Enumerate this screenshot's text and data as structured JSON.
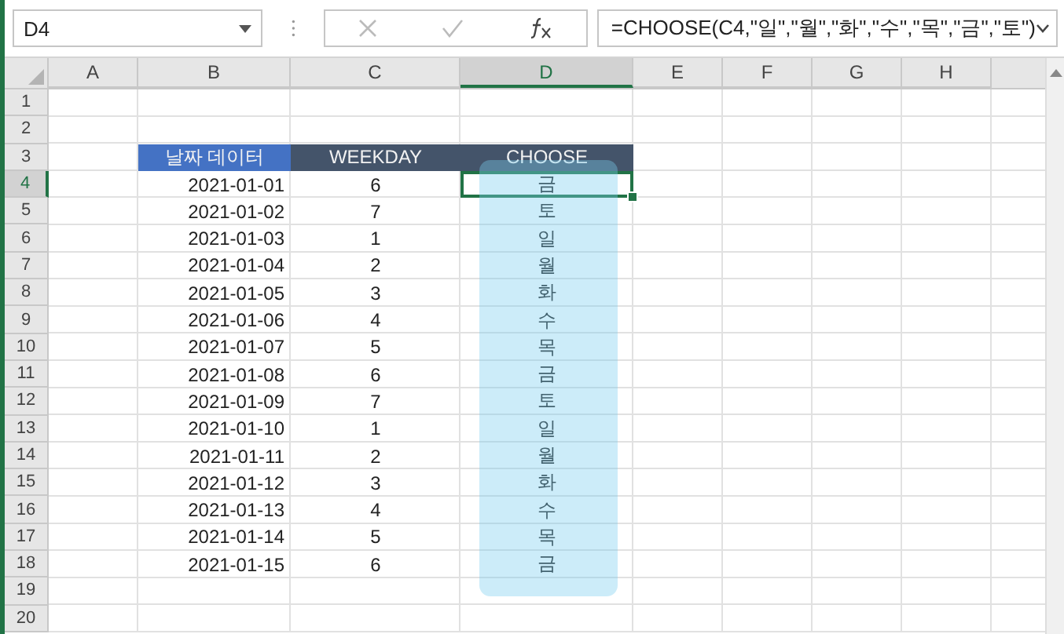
{
  "name_box": "D4",
  "formula": "=CHOOSE(C4,\"일\",\"월\",\"화\",\"수\",\"목\",\"금\",\"토\")",
  "columns": [
    {
      "label": "A",
      "selected": false
    },
    {
      "label": "B",
      "selected": false
    },
    {
      "label": "C",
      "selected": false
    },
    {
      "label": "D",
      "selected": true
    },
    {
      "label": "E",
      "selected": false
    },
    {
      "label": "F",
      "selected": false
    },
    {
      "label": "G",
      "selected": false
    },
    {
      "label": "H",
      "selected": false
    }
  ],
  "rows": [
    {
      "label": "1",
      "selected": false
    },
    {
      "label": "2",
      "selected": false
    },
    {
      "label": "3",
      "selected": false,
      "cells": [
        {
          "text": "날짜 데이터",
          "color": "#4472c4"
        },
        {
          "text": "WEEKDAY",
          "color": "#44546a"
        },
        {
          "text": "CHOOSE",
          "color": "#44546a"
        }
      ]
    },
    {
      "label": "4",
      "selected": true,
      "cells": [
        {
          "text": "2021-01-01"
        },
        {
          "text": "6"
        },
        {
          "text": "금",
          "selected": true
        }
      ]
    },
    {
      "label": "5",
      "selected": false,
      "cells": [
        {
          "text": "2021-01-02"
        },
        {
          "text": "7"
        },
        {
          "text": "토",
          "selected": false
        }
      ]
    },
    {
      "label": "6",
      "selected": false,
      "cells": [
        {
          "text": "2021-01-03"
        },
        {
          "text": "1"
        },
        {
          "text": "일",
          "selected": false
        }
      ]
    },
    {
      "label": "7",
      "selected": false,
      "cells": [
        {
          "text": "2021-01-04"
        },
        {
          "text": "2"
        },
        {
          "text": "월",
          "selected": false
        }
      ]
    },
    {
      "label": "8",
      "selected": false,
      "cells": [
        {
          "text": "2021-01-05"
        },
        {
          "text": "3"
        },
        {
          "text": "화",
          "selected": false
        }
      ]
    },
    {
      "label": "9",
      "selected": false,
      "cells": [
        {
          "text": "2021-01-06"
        },
        {
          "text": "4"
        },
        {
          "text": "수",
          "selected": false
        }
      ]
    },
    {
      "label": "10",
      "selected": false,
      "cells": [
        {
          "text": "2021-01-07"
        },
        {
          "text": "5"
        },
        {
          "text": "목",
          "selected": false
        }
      ]
    },
    {
      "label": "11",
      "selected": false,
      "cells": [
        {
          "text": "2021-01-08"
        },
        {
          "text": "6"
        },
        {
          "text": "금",
          "selected": false
        }
      ]
    },
    {
      "label": "12",
      "selected": false,
      "cells": [
        {
          "text": "2021-01-09"
        },
        {
          "text": "7"
        },
        {
          "text": "토",
          "selected": false
        }
      ]
    },
    {
      "label": "13",
      "selected": false,
      "cells": [
        {
          "text": "2021-01-10"
        },
        {
          "text": "1"
        },
        {
          "text": "일",
          "selected": false
        }
      ]
    },
    {
      "label": "14",
      "selected": false,
      "cells": [
        {
          "text": "2021-01-11"
        },
        {
          "text": "2"
        },
        {
          "text": "월",
          "selected": false
        }
      ]
    },
    {
      "label": "15",
      "selected": false,
      "cells": [
        {
          "text": "2021-01-12"
        },
        {
          "text": "3"
        },
        {
          "text": "화",
          "selected": false
        }
      ]
    },
    {
      "label": "16",
      "selected": false,
      "cells": [
        {
          "text": "2021-01-13"
        },
        {
          "text": "4"
        },
        {
          "text": "수",
          "selected": false
        }
      ]
    },
    {
      "label": "17",
      "selected": false,
      "cells": [
        {
          "text": "2021-01-14"
        },
        {
          "text": "5"
        },
        {
          "text": "목",
          "selected": false
        }
      ]
    },
    {
      "label": "18",
      "selected": false,
      "cells": [
        {
          "text": "2021-01-15"
        },
        {
          "text": "6"
        },
        {
          "text": "금",
          "selected": false
        }
      ]
    },
    {
      "label": "19",
      "selected": false
    },
    {
      "label": "20",
      "selected": false
    }
  ]
}
